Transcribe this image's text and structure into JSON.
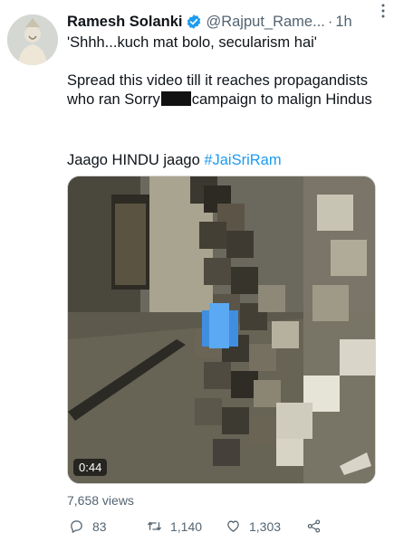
{
  "author": {
    "display_name": "Ramesh Solanki",
    "handle": "@Rajput_Rame...",
    "separator": "·",
    "time": "1h"
  },
  "tweet": {
    "line1": "'Shhh...kuch mat bolo, secularism hai'",
    "para2_part1": "Spread this video till it reaches propagandists who ran Sorry",
    "para2_part2": "campaign to malign Hindus",
    "para3_text": "Jaago HINDU jaago ",
    "hashtag": "#JaiSriRam"
  },
  "media": {
    "duration": "0:44"
  },
  "stats": {
    "views": "7,658 views",
    "replies": "83",
    "retweets": "1,140",
    "likes": "1,303"
  },
  "colors": {
    "link": "#1d9bf0",
    "secondary_text": "#536471",
    "verified": "#1d9bf0"
  },
  "icons": [
    "verified-icon",
    "more-icon",
    "reply-icon",
    "retweet-icon",
    "like-icon",
    "share-icon"
  ]
}
